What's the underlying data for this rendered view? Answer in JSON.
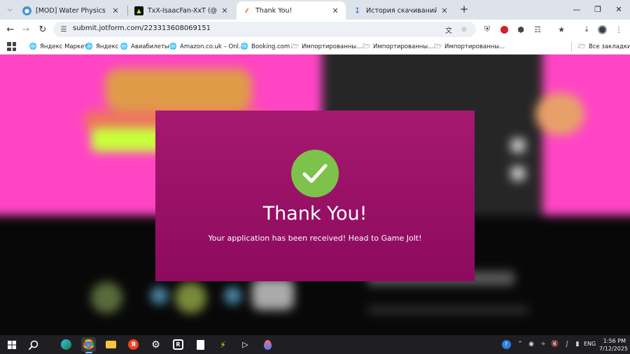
{
  "browser": {
    "tabs": [
      {
        "title": "[MOD] Water Physics for Peop",
        "active": false,
        "favicon": "globe-blue-icon"
      },
      {
        "title": "TxX-IsaacFan-XxT (@xXxTHorne",
        "active": false,
        "favicon": "gamejolt-icon"
      },
      {
        "title": "Thank You!",
        "active": true,
        "favicon": "jotform-icon"
      },
      {
        "title": "История скачиваний",
        "active": false,
        "favicon": "download-icon"
      }
    ],
    "url": "submit.jotform.com/223313608069151",
    "bookmarks": [
      {
        "label": "Яндекс Маркет",
        "icon": "globe-icon"
      },
      {
        "label": "Яндекс",
        "icon": "globe-icon"
      },
      {
        "label": "Авиабилеты",
        "icon": "globe-icon"
      },
      {
        "label": "Amazon.co.uk – Onl...",
        "icon": "globe-icon"
      },
      {
        "label": "Booking.com",
        "icon": "globe-icon"
      },
      {
        "label": "Импортированны...",
        "icon": "folder-icon"
      },
      {
        "label": "Импортированны...",
        "icon": "folder-icon"
      },
      {
        "label": "Импортированны...",
        "icon": "folder-icon"
      }
    ],
    "all_bookmarks_label": "Все закладки"
  },
  "page": {
    "title": "Thank You!",
    "message": "Your application has been received! Head to Game Jolt!",
    "card_color": "#9b0f67",
    "check_color": "#7dc24a",
    "background_accent": "#ff4fc6"
  },
  "taskbar": {
    "language": "ENG",
    "time": "1:56 PM",
    "date": "7/12/2025"
  }
}
